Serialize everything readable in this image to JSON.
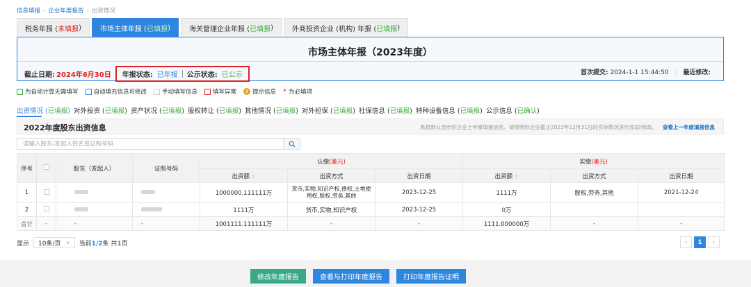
{
  "breadcrumb": {
    "items": [
      "信息填报",
      "企业年度报告"
    ],
    "current": "出资情况"
  },
  "tabs": [
    {
      "label": "税务年报 (",
      "status": "未填报",
      "end": ")",
      "status_color": "red"
    },
    {
      "label": "市场主体年报 (",
      "status": "已填报",
      "end": ")",
      "status_color": "green"
    },
    {
      "label": "海关管理企业年报 (",
      "status": "已填报",
      "end": ")",
      "status_color": "green"
    },
    {
      "label": "外商投资企业 (机构) 年报 (",
      "status": "已填报",
      "end": ")",
      "status_color": "green"
    }
  ],
  "panel": {
    "title": "市场主体年报（2023年度）",
    "deadline_label": "截止日期:",
    "deadline_value": "2024年6月30日",
    "report_status_label": "年报状态:",
    "report_status_value": "已年报",
    "public_status_label": "公示状态:",
    "public_status_value": "已公示",
    "first_submit_label": "首次提交:",
    "first_submit_value": "2024-1-1 15:44:50",
    "last_modify_label": "最近修改:"
  },
  "legend": [
    {
      "label": "为自动计算无需填写",
      "color": "#3bab3b",
      "type": "box"
    },
    {
      "label": "自动填充信息可修改",
      "color": "#2e86de",
      "type": "box"
    },
    {
      "label": "手动填写信息",
      "color": "#cccccc",
      "type": "box"
    },
    {
      "label": "填写异常",
      "color": "#e02020",
      "type": "box"
    },
    {
      "label": "提示信息",
      "color": "#f0a020",
      "type": "warn"
    },
    {
      "label": "为必填项",
      "color": "#e02020",
      "type": "star"
    }
  ],
  "subnav": [
    {
      "label": "出资情况",
      "status": "已填报"
    },
    {
      "label": "对外投资",
      "status": "已填报"
    },
    {
      "label": "资产状况",
      "status": "已填报"
    },
    {
      "label": "股权转让",
      "status": "已填报"
    },
    {
      "label": "其他情况",
      "status": "已填报"
    },
    {
      "label": "对外担保",
      "status": "已填报"
    },
    {
      "label": "社保信息",
      "status": "已填报"
    },
    {
      "label": "特种设备信息",
      "status": "已填报"
    },
    {
      "label": "公示信息",
      "status": "已确认"
    }
  ],
  "section": {
    "title": "2022年度股东出资信息",
    "note": "系统默认显示你企业上年度填报信息，请按照你企业截止2023年12月31日的实际情况进行添加/修改。",
    "link": "查看上一年度填报信息"
  },
  "search": {
    "placeholder": "请输入股东/发起人姓名或证照号码",
    "value": ""
  },
  "table": {
    "headers": {
      "no": "序号",
      "shareholder": "股东（发起人）",
      "license": "证照号码",
      "subscribed": "认缴",
      "paid": "实缴",
      "currency": "(美元)",
      "amount": "出资额",
      "method": "出资方式",
      "date": "出资日期",
      "sort_glyph": "⇕"
    },
    "rows": [
      {
        "no": "1",
        "sub_amount": "1000000.111111万",
        "sub_method": "货币,实物,知识产权,债权,土地使用权,股权,劳务,其他",
        "sub_date": "2023-12-25",
        "paid_amount": "1111万",
        "paid_method": "股权,劳务,其他",
        "paid_date": "2021-12-24"
      },
      {
        "no": "2",
        "sub_amount": "1111万",
        "sub_method": "货币,实物,知识产权",
        "sub_date": "2023-12-25",
        "paid_amount": "0万",
        "paid_method": "",
        "paid_date": ""
      }
    ],
    "total": {
      "label": "合计",
      "dash": "-",
      "sub_amount": "1001111.111111万",
      "paid_amount": "1111.000000万"
    }
  },
  "pagination": {
    "show_label": "显示",
    "page_size": "10条/页",
    "current_prefix": "当前",
    "current": "1/2",
    "count_label": "条 共",
    "pages": "1",
    "pages_suffix": "页",
    "page_number": "1",
    "prev": "‹",
    "next": "›"
  },
  "actions": {
    "modify": "修改年度报告",
    "view_print": "查看与打印年度报告",
    "print_cert": "打印年度报告证明"
  }
}
